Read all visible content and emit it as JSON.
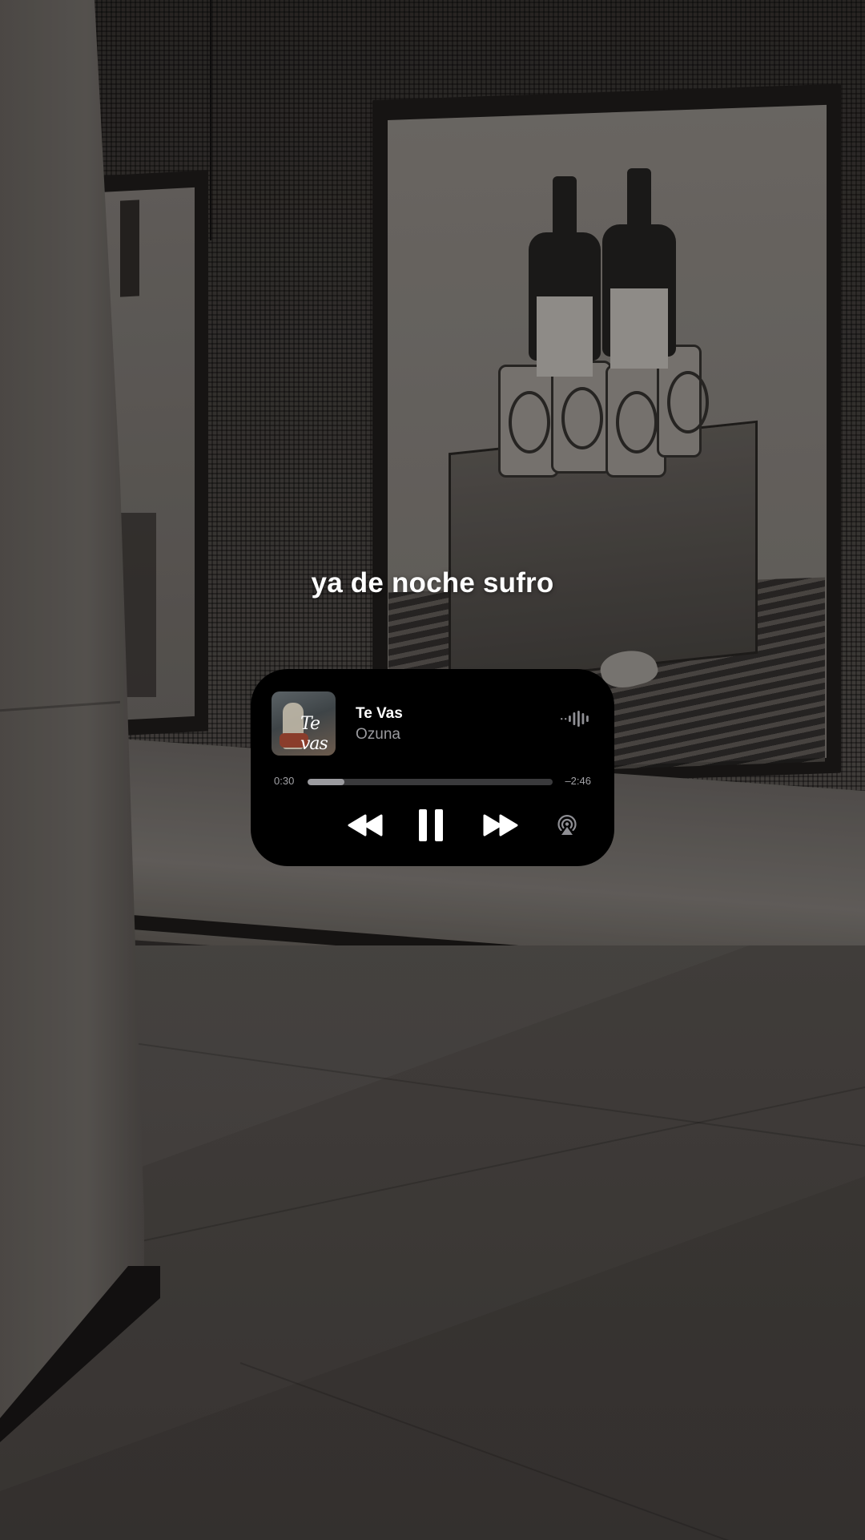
{
  "lyric": {
    "text": "ya de noche sufro"
  },
  "player": {
    "album_art": {
      "text": "Te vas"
    },
    "title": "Te Vas",
    "artist": "Ozuna",
    "elapsed": "0:30",
    "remaining": "–2:46",
    "progress": 0.15,
    "icons": {
      "audio_indicator": "waveform-icon",
      "previous": "rewind-icon",
      "play_pause": "pause-icon",
      "next": "fast-forward-icon",
      "output": "airplay-icon"
    },
    "colors": {
      "background": "#000000",
      "title": "#ffffff",
      "artist": "#9a9a9e",
      "track": "#3a3a3c",
      "fill": "#9b9b9f"
    }
  }
}
